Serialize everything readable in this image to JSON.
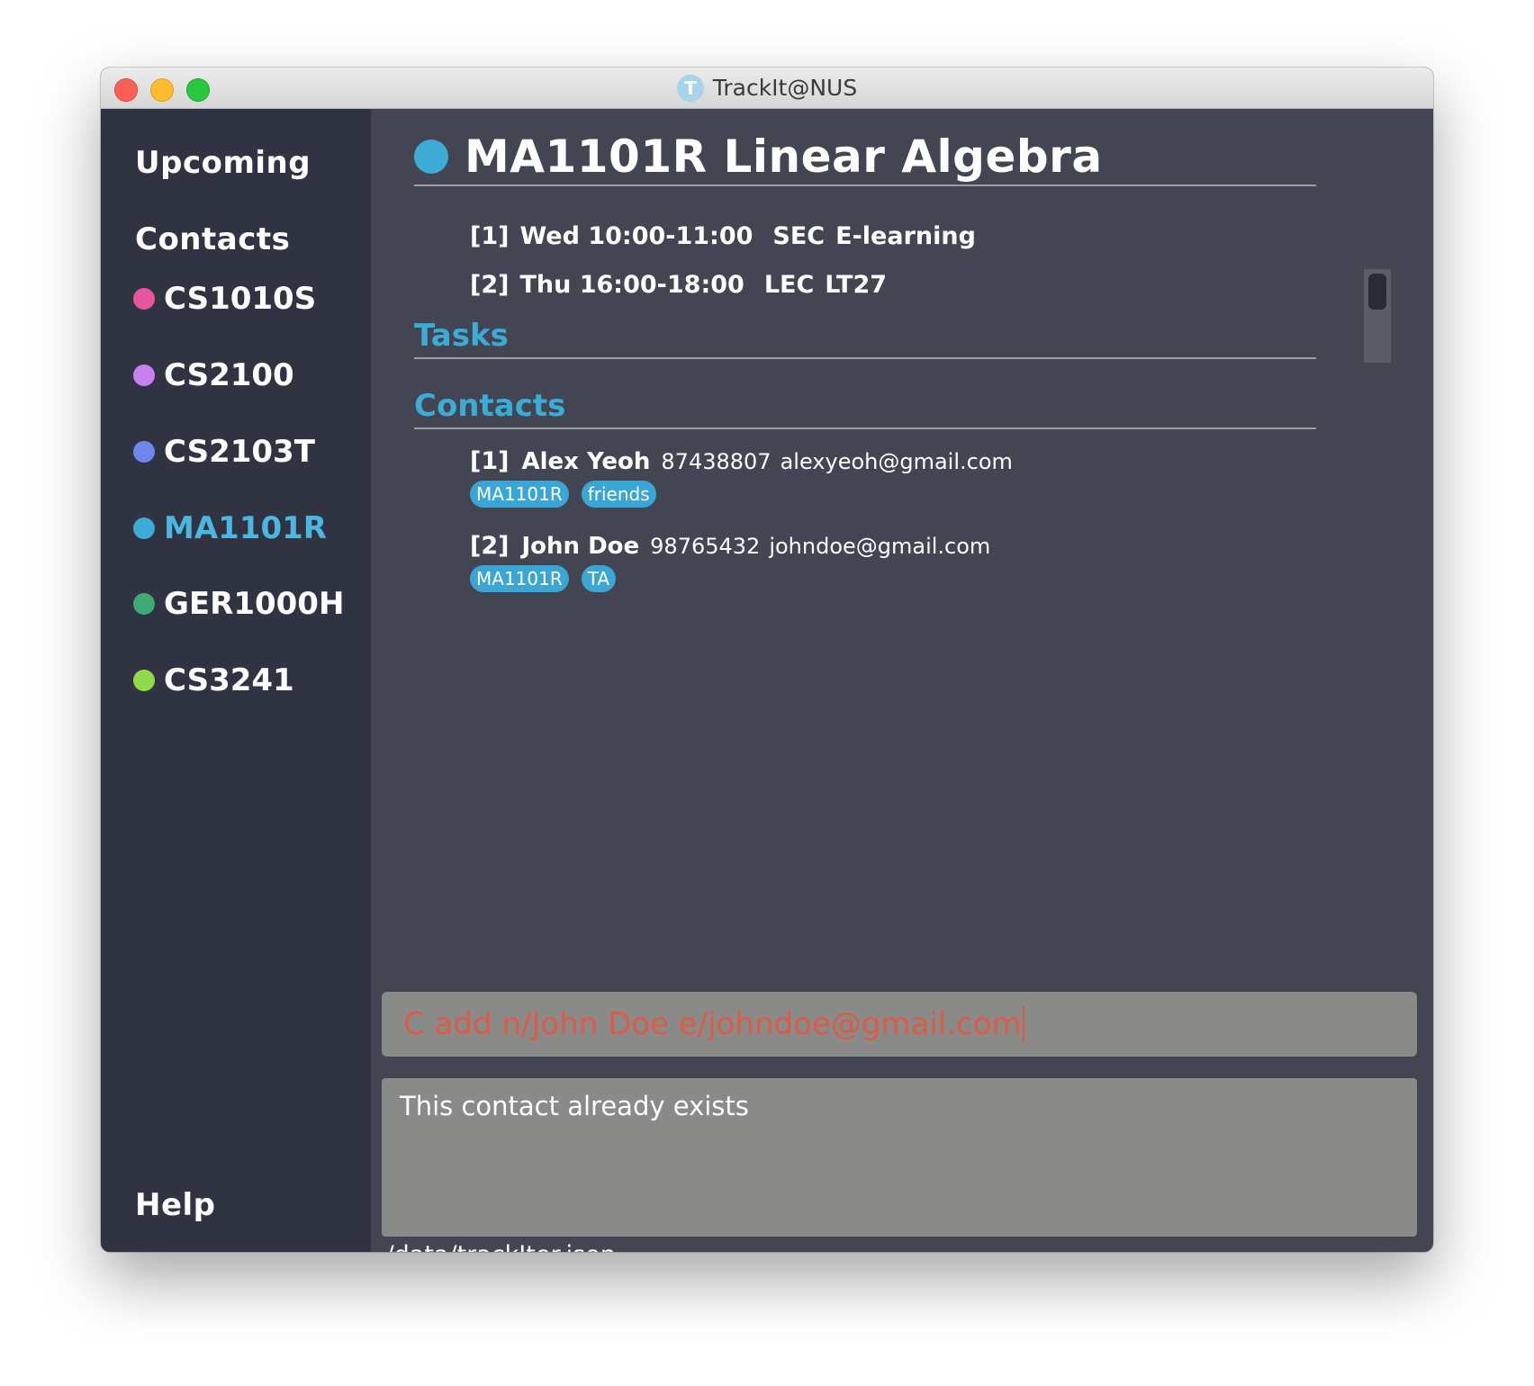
{
  "window": {
    "title": "TrackIt@NUS",
    "icon_letter": "T"
  },
  "sidebar": {
    "upcoming": "Upcoming",
    "contacts": "Contacts",
    "help": "Help",
    "modules": [
      {
        "code": "CS1010S",
        "color": "#e8559f",
        "active": false
      },
      {
        "code": "CS2100",
        "color": "#c780f0",
        "active": false
      },
      {
        "code": "CS2103T",
        "color": "#6f86ef",
        "active": false
      },
      {
        "code": "MA1101R",
        "color": "#3cabd6",
        "active": true
      },
      {
        "code": "GER1000H",
        "color": "#3fa877",
        "active": false
      },
      {
        "code": "CS3241",
        "color": "#8fd94a",
        "active": false
      }
    ]
  },
  "main": {
    "module_title": "MA1101R Linear Algebra",
    "module_color": "#3cabd6",
    "lessons": [
      {
        "index": "[1]",
        "time": "Wed 10:00-11:00",
        "type": "SEC",
        "venue": "E-learning"
      },
      {
        "index": "[2]",
        "time": "Thu 16:00-18:00",
        "type": "LEC",
        "venue": "LT27"
      }
    ],
    "tasks_title": "Tasks",
    "contacts_title": "Contacts",
    "contacts": [
      {
        "index": "[1]",
        "name": "Alex Yeoh",
        "phone": "87438807",
        "email": "alexyeoh@gmail.com",
        "tags": [
          "MA1101R",
          "friends"
        ]
      },
      {
        "index": "[2]",
        "name": "John Doe",
        "phone": "98765432",
        "email": "johndoe@gmail.com",
        "tags": [
          "MA1101R",
          "TA"
        ]
      }
    ]
  },
  "command": {
    "value": "C add n/John Doe e/johndoe@gmail.com"
  },
  "result": {
    "message": "This contact already exists"
  },
  "status": {
    "file_path": "./data/trackIter.json"
  },
  "colors": {
    "accent": "#3cabd6",
    "error_text": "#df5a45"
  }
}
